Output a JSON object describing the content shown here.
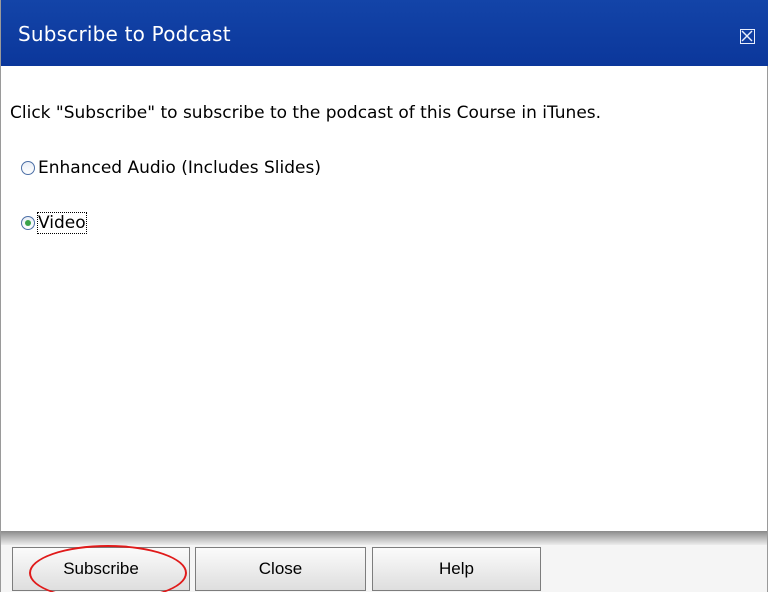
{
  "dialog": {
    "title": "Subscribe to Podcast",
    "close_icon": "close-box-icon",
    "title_bar_color": "#0b379b"
  },
  "content": {
    "instruction": "Click \"Subscribe\" to subscribe to the podcast of this Course in iTunes.",
    "options": [
      {
        "label": "Enhanced Audio (Includes Slides)",
        "selected": false
      },
      {
        "label": "Video",
        "selected": true
      }
    ]
  },
  "footer": {
    "subscribe_label": "Subscribe",
    "close_label": "Close",
    "help_label": "Help"
  },
  "annotation": {
    "highlight_color": "#e01a1a"
  }
}
